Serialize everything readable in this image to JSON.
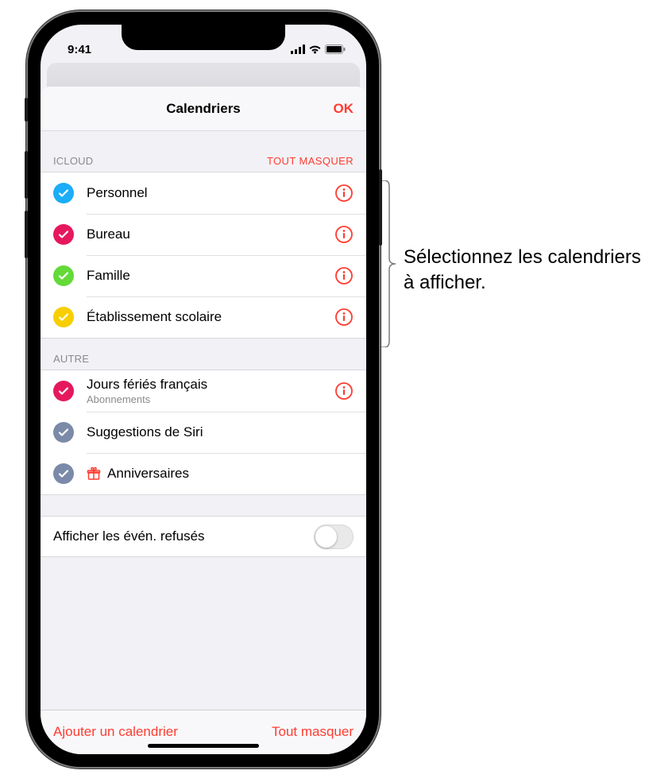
{
  "status": {
    "time": "9:41"
  },
  "sheet": {
    "title": "Calendriers",
    "done": "OK"
  },
  "sections": {
    "icloud": {
      "label": "ICLOUD",
      "action": "TOUT MASQUER",
      "items": [
        {
          "label": "Personnel",
          "color": "#1badf8"
        },
        {
          "label": "Bureau",
          "color": "#e6185d"
        },
        {
          "label": "Famille",
          "color": "#63da38"
        },
        {
          "label": "Établissement scolaire",
          "color": "#f7ce00"
        }
      ]
    },
    "other": {
      "label": "AUTRE",
      "items": [
        {
          "label": "Jours fériés français",
          "sublabel": "Abonnements",
          "color": "#e6185d",
          "info": true
        },
        {
          "label": "Suggestions de Siri",
          "color": "#7b8aa8",
          "info": false
        },
        {
          "label": "Anniversaires",
          "color": "#7b8aa8",
          "info": false,
          "gift": true
        }
      ]
    }
  },
  "declined": {
    "label": "Afficher les évén. refusés",
    "on": false
  },
  "toolbar": {
    "add": "Ajouter un calendrier",
    "hideAll": "Tout masquer"
  },
  "callout": "Sélectionnez les calendriers à afficher."
}
